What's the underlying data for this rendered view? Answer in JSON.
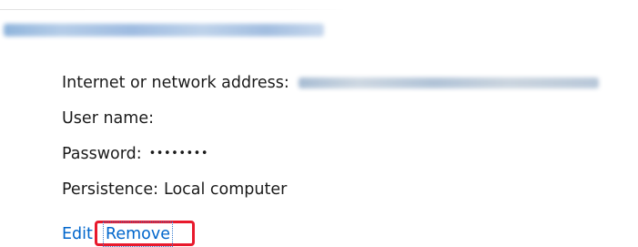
{
  "credential": {
    "fields": {
      "address_label": "Internet or network address:",
      "username_label": "User name:",
      "password_label": "Password:",
      "password_mask": "••••••••",
      "persistence_label": "Persistence:",
      "persistence_value": "Local computer"
    },
    "actions": {
      "edit_label": "Edit",
      "remove_label": "Remove"
    }
  },
  "colors": {
    "link": "#0066cc",
    "highlight_box": "#e8192c",
    "text": "#1b1b1b"
  }
}
